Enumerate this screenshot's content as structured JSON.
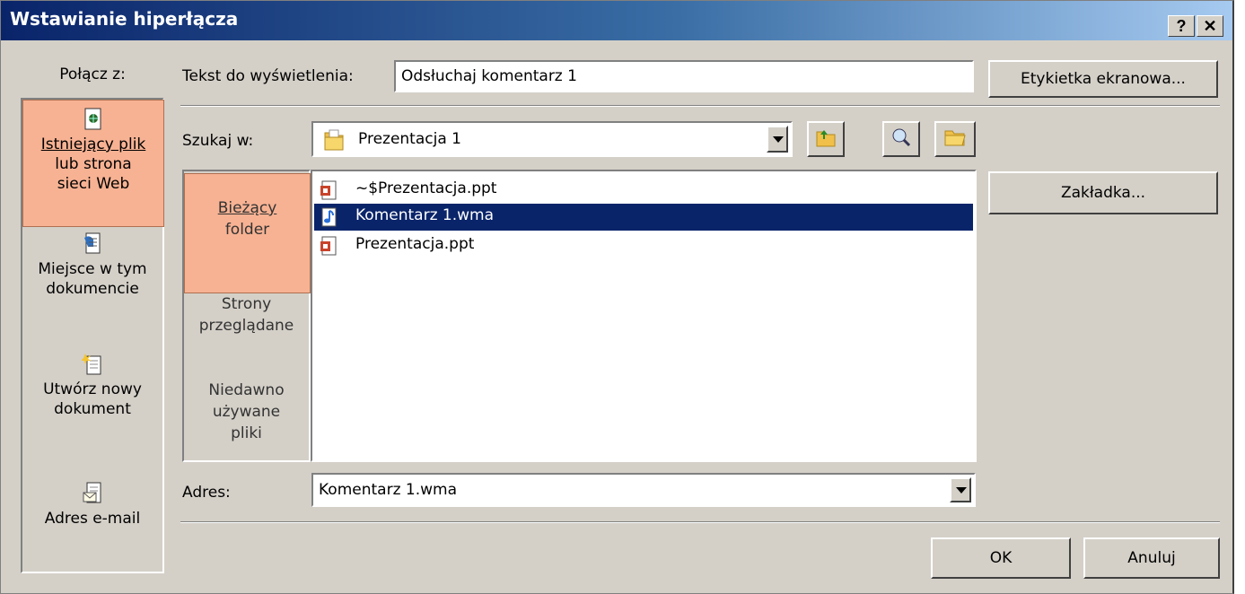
{
  "dialog": {
    "title": "Wstawianie hiperłącza",
    "help_button": "?",
    "close_button": "✕"
  },
  "link_to": {
    "label": "Połącz z:",
    "items": [
      {
        "line1": "Istniejący plik",
        "line2": "lub strona",
        "line3": "sieci Web",
        "icon": "existing-file-icon",
        "selected": true
      },
      {
        "line1": "Miejsce w tym",
        "line2": "dokumencie",
        "icon": "place-in-document-icon",
        "selected": false
      },
      {
        "line1": "Utwórz nowy",
        "line2": "dokument",
        "icon": "new-document-icon",
        "selected": false
      },
      {
        "line1": "Adres e-mail",
        "icon": "email-address-icon",
        "selected": false
      }
    ]
  },
  "text_to_display": {
    "label": "Tekst do wyświetlenia:",
    "value": "Odsłuchaj komentarz 1"
  },
  "screentip_button": "Etykietka ekranowa...",
  "look_in": {
    "label": "Szukaj w:",
    "value": "Prezentacja 1"
  },
  "places": [
    {
      "line1": "Bieżący",
      "line2": "folder",
      "selected": true
    },
    {
      "line1": "Strony",
      "line2": "przeglądane",
      "selected": false
    },
    {
      "line1": "Niedawno",
      "line2": "używane",
      "line3": "pliki",
      "selected": false
    }
  ],
  "files": [
    {
      "name": "~$Prezentacja.ppt",
      "icon": "powerpoint-file-icon",
      "selected": false
    },
    {
      "name": "Komentarz 1.wma",
      "icon": "audio-file-icon",
      "selected": true
    },
    {
      "name": "Prezentacja.ppt",
      "icon": "powerpoint-file-icon",
      "selected": false
    }
  ],
  "bookmark_button": "Zakładka...",
  "address": {
    "label": "Adres:",
    "value": "Komentarz 1.wma"
  },
  "ok_button": "OK",
  "cancel_button": "Anuluj",
  "colors": {
    "title_start": "#0a246a",
    "selection": "#0a246a",
    "highlight": "#f7b293",
    "face": "#d4d0c8"
  }
}
